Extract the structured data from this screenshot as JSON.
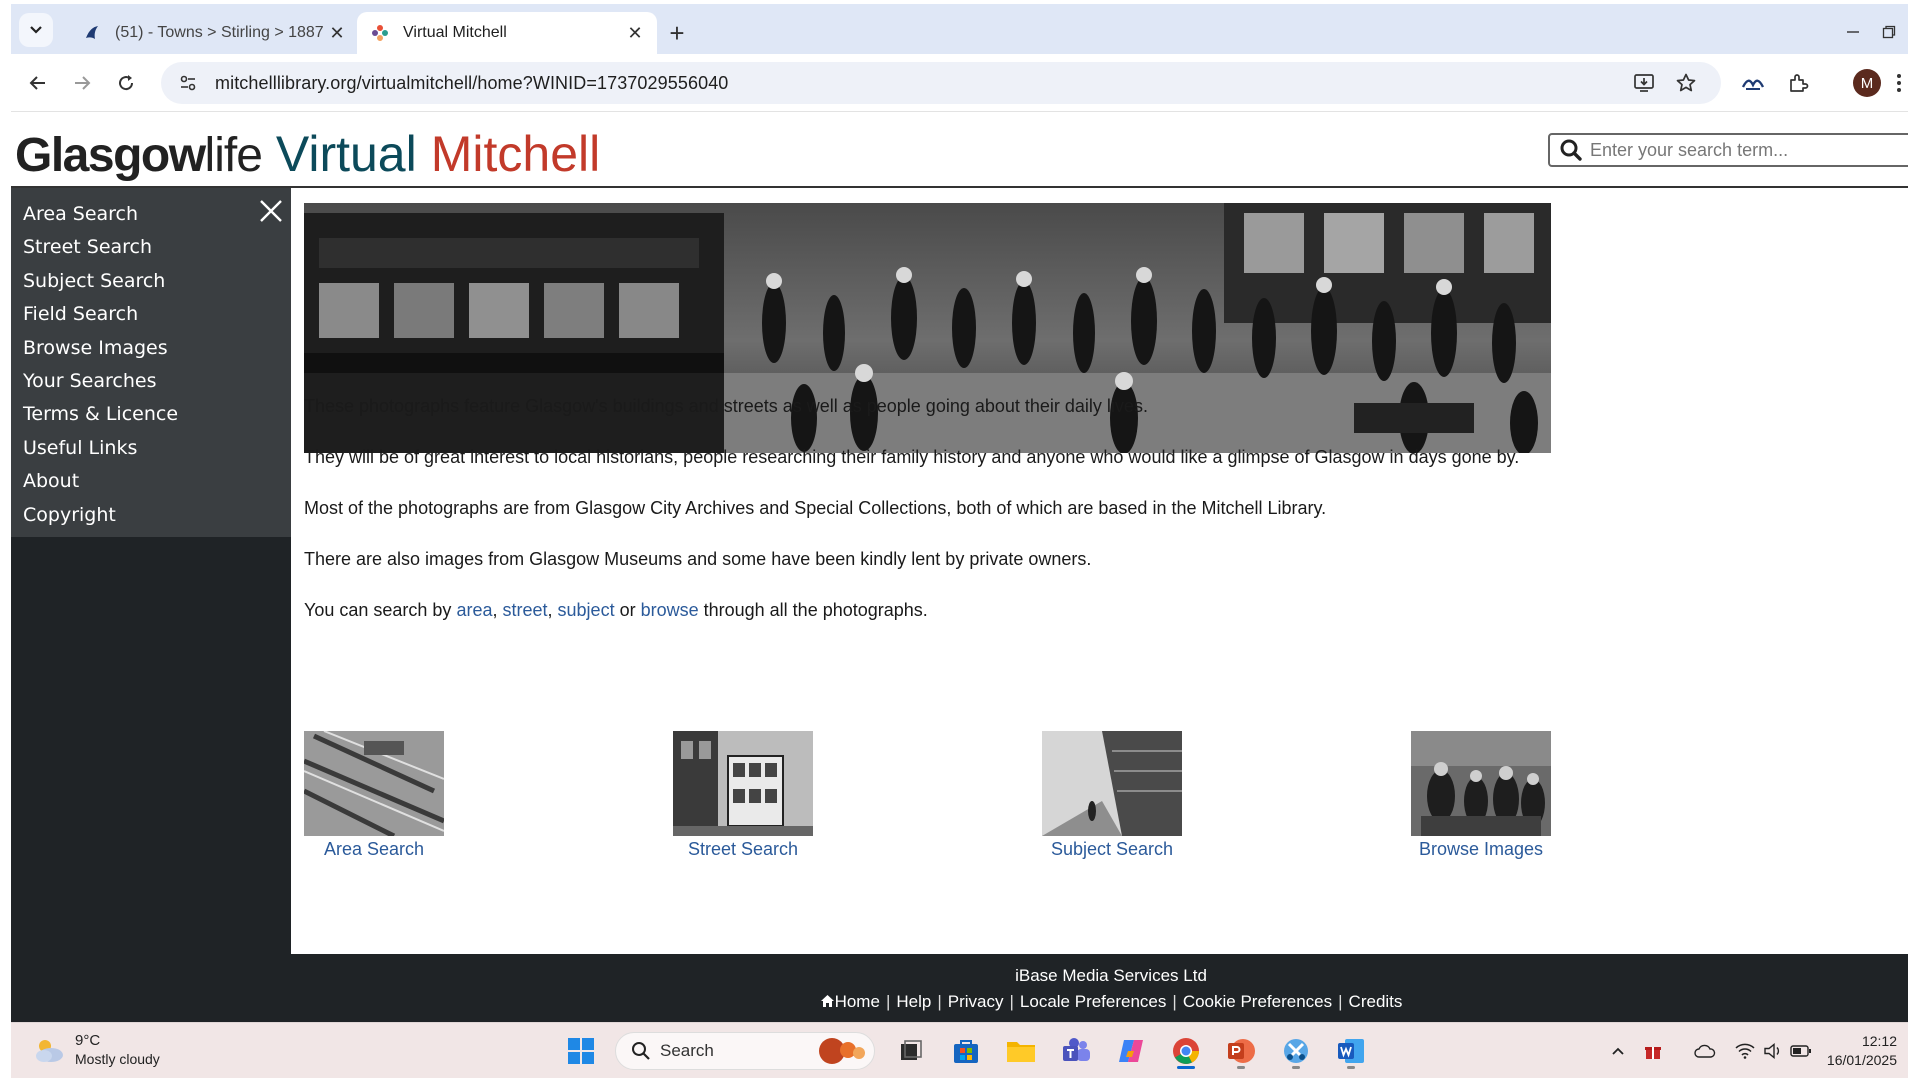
{
  "browser": {
    "tabs": [
      {
        "title": "(51) - Towns > Stirling > 1887 -",
        "active": false
      },
      {
        "title": "Virtual Mitchell",
        "active": true
      }
    ],
    "url": "mitchelllibrary.org/virtualmitchell/home?WINID=1737029556040",
    "profile_initial": "M"
  },
  "site": {
    "logo": {
      "glasgow": "Glasgow",
      "life": "life",
      "virtual": "Virtual",
      "mitchell": "Mitchell"
    },
    "search_placeholder": "Enter your search term..."
  },
  "sidebar": {
    "items": [
      {
        "label": "Area Search"
      },
      {
        "label": "Street Search"
      },
      {
        "label": "Subject Search"
      },
      {
        "label": "Field Search"
      },
      {
        "label": "Browse Images"
      },
      {
        "label": "Your Searches"
      },
      {
        "label": "Terms & Licence"
      },
      {
        "label": "Useful Links"
      },
      {
        "label": "About"
      },
      {
        "label": "Copyright"
      }
    ]
  },
  "main": {
    "paragraphs": [
      "These photographs feature Glasgow's buildings and streets as well as people going about their daily lives.",
      "They will be of great interest to local historians, people researching their family history and anyone who would like a glimpse of Glasgow in days gone by.",
      "Most of the photographs are from Glasgow City Archives and Special Collections, both of which are based in the Mitchell Library.",
      "There are also images from Glasgow Museums and some have been kindly lent by private owners."
    ],
    "search_sentence": {
      "prefix": "You can search by ",
      "area": "area",
      "comma1": ", ",
      "street": "street",
      "comma2": ", ",
      "subject": "subject",
      "or": " or ",
      "browse": "browse",
      "suffix": " through all the photographs."
    },
    "thumbnails": [
      {
        "label": "Area Search"
      },
      {
        "label": "Street Search"
      },
      {
        "label": "Subject Search"
      },
      {
        "label": "Browse Images"
      }
    ]
  },
  "footer": {
    "company": "iBase Media Services Ltd",
    "links": [
      "Home",
      "Help",
      "Privacy",
      "Locale Preferences",
      "Cookie Preferences",
      "Credits"
    ],
    "separator": "|"
  },
  "taskbar": {
    "weather_temp": "9°C",
    "weather_desc": "Mostly cloudy",
    "search_label": "Search",
    "time": "12:12",
    "date": "16/01/2025"
  },
  "colors": {
    "sidebar_bg": "#1f2326",
    "menu_bg": "#3a3e41",
    "link": "#2b5a9a",
    "mitchell_red": "#c23a2a",
    "virtual_teal": "#0c4a5a"
  }
}
